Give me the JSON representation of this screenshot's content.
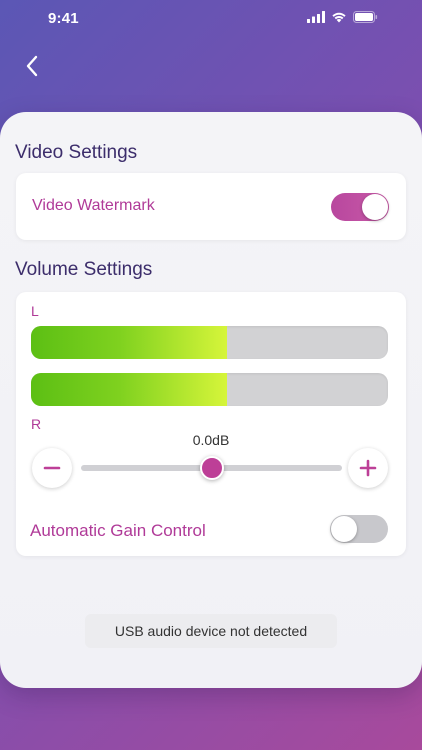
{
  "status_bar": {
    "time": "9:41",
    "icons": [
      "cellular-signal-icon",
      "wifi-icon",
      "battery-icon"
    ]
  },
  "nav": {
    "back_icon": "chevron-left-icon"
  },
  "video_settings": {
    "title": "Video Settings",
    "watermark_label": "Video Watermark",
    "watermark_enabled": true
  },
  "volume_settings": {
    "title": "Volume Settings",
    "left_label": "L",
    "right_label": "R",
    "left_level": 0.55,
    "right_level": 0.55,
    "gain_readout": "0.0dB",
    "slider_position": 0.5,
    "decrease_icon": "minus-icon",
    "increase_icon": "plus-icon",
    "agc_label": "Automatic Gain Control",
    "agc_enabled": false
  },
  "notice": {
    "text": "USB audio device not detected"
  },
  "colors": {
    "accent": "#bd3f97",
    "title": "#3c2d6b",
    "meter_green": "#5cbf14",
    "meter_yellow": "#d6f53a"
  }
}
